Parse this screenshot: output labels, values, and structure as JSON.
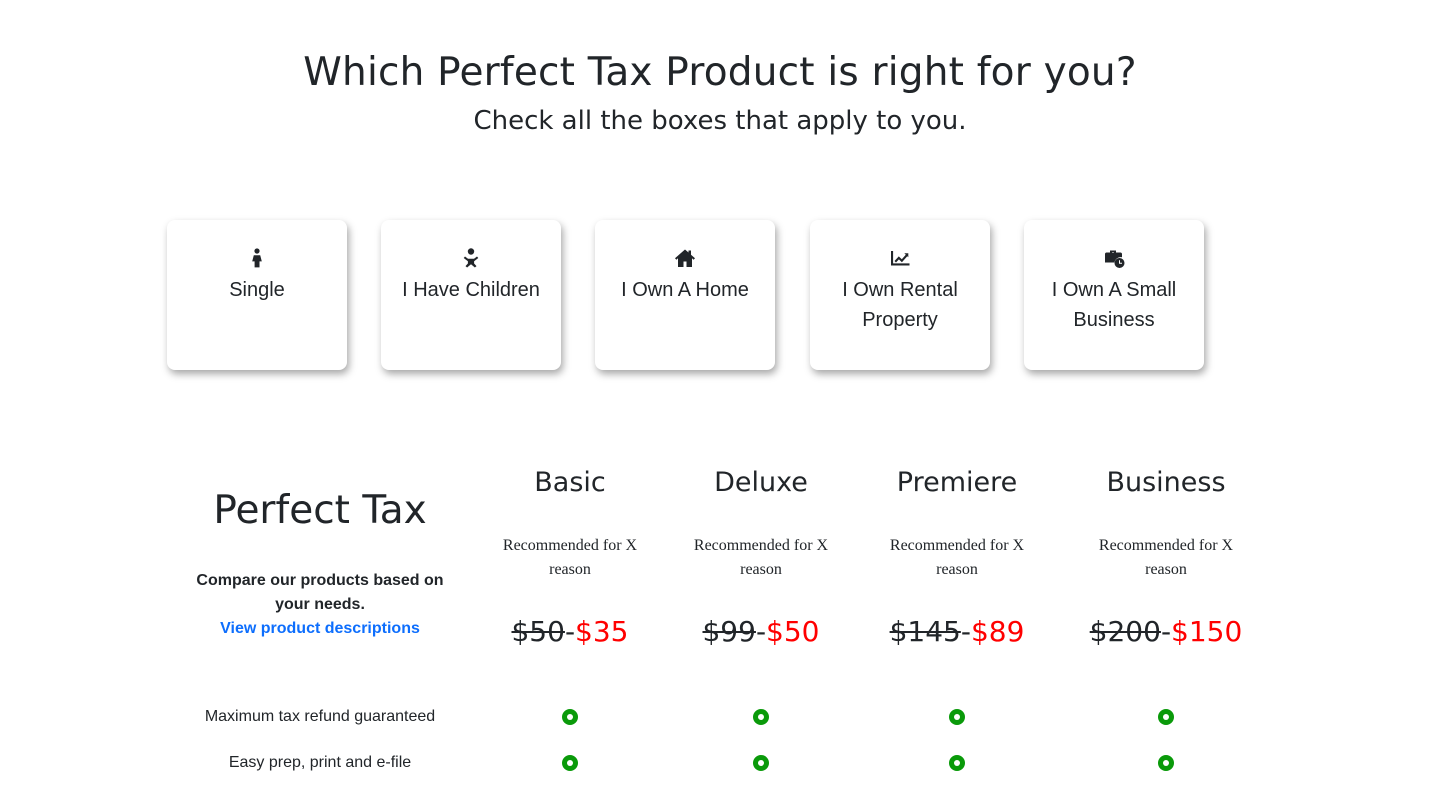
{
  "header": {
    "title": "Which Perfect Tax Product is right for you?",
    "subtitle": "Check all the boxes that apply to you."
  },
  "options": [
    {
      "label": "Single",
      "icon": "person-icon"
    },
    {
      "label": "I Have Children",
      "icon": "baby-icon"
    },
    {
      "label": "I Own A Home",
      "icon": "home-icon"
    },
    {
      "label": "I Own Rental Property",
      "icon": "chart-line-icon"
    },
    {
      "label": "I Own A Small Business",
      "icon": "business-time-icon"
    }
  ],
  "comparison": {
    "brand": "Perfect Tax",
    "description": "Compare our products based on your needs.",
    "link_text": "View product descriptions",
    "link_color": "#0d6efd"
  },
  "plans": [
    {
      "name": "Basic",
      "recommendation": "Recommended for X reason",
      "old_price": "$50",
      "separator": "-",
      "new_price": "$35"
    },
    {
      "name": "Deluxe",
      "recommendation": "Recommended for X reason",
      "old_price": "$99",
      "separator": "-",
      "new_price": "$50"
    },
    {
      "name": "Premiere",
      "recommendation": "Recommended for X reason",
      "old_price": "$145",
      "separator": "-",
      "new_price": "$89"
    },
    {
      "name": "Business",
      "recommendation": "Recommended for X reason",
      "old_price": "$200",
      "separator": "-",
      "new_price": "$150"
    }
  ],
  "features": [
    {
      "label": "Maximum tax refund guaranteed",
      "included": [
        true,
        true,
        true,
        true
      ]
    },
    {
      "label": "Easy prep, print and e-file",
      "included": [
        true,
        true,
        true,
        true
      ]
    }
  ],
  "colors": {
    "sale_price": "#ff0000",
    "check": "#0a9a0a",
    "text": "#212529"
  }
}
